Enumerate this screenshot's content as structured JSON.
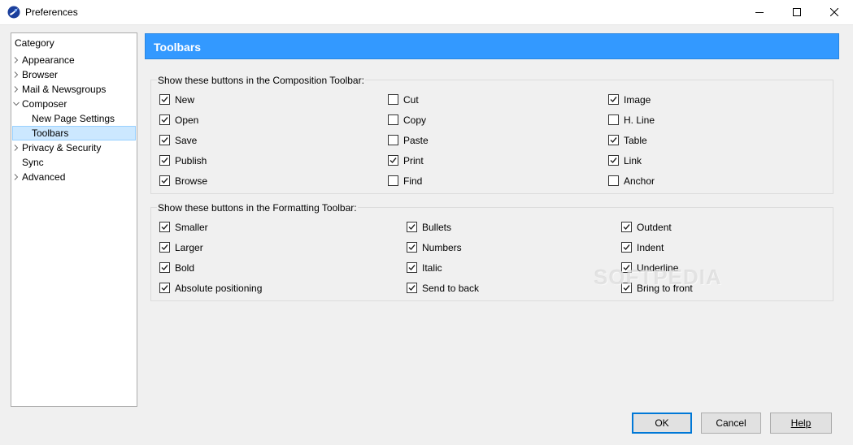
{
  "window": {
    "title": "Preferences"
  },
  "sidebar": {
    "heading": "Category",
    "items": [
      {
        "label": "Appearance",
        "twisty": "collapsed"
      },
      {
        "label": "Browser",
        "twisty": "collapsed"
      },
      {
        "label": "Mail & Newsgroups",
        "twisty": "collapsed"
      },
      {
        "label": "Composer",
        "twisty": "expanded"
      },
      {
        "label": "New Page Settings",
        "twisty": "none"
      },
      {
        "label": "Toolbars",
        "twisty": "none",
        "selected": true
      },
      {
        "label": "Privacy & Security",
        "twisty": "collapsed"
      },
      {
        "label": "Sync",
        "twisty": "none"
      },
      {
        "label": "Advanced",
        "twisty": "collapsed"
      }
    ]
  },
  "panel": {
    "title": "Toolbars",
    "composition": {
      "legend": "Show these buttons in the Composition Toolbar:",
      "items": [
        {
          "label": "New",
          "checked": true
        },
        {
          "label": "Open",
          "checked": true
        },
        {
          "label": "Save",
          "checked": true
        },
        {
          "label": "Publish",
          "checked": true
        },
        {
          "label": "Browse",
          "checked": true
        },
        {
          "label": "Cut",
          "checked": false
        },
        {
          "label": "Copy",
          "checked": false
        },
        {
          "label": "Paste",
          "checked": false
        },
        {
          "label": "Print",
          "checked": true
        },
        {
          "label": "Find",
          "checked": false
        },
        {
          "label": "Image",
          "checked": true
        },
        {
          "label": "H. Line",
          "checked": false
        },
        {
          "label": "Table",
          "checked": true
        },
        {
          "label": "Link",
          "checked": true
        },
        {
          "label": "Anchor",
          "checked": false
        }
      ]
    },
    "formatting": {
      "legend": "Show these buttons in the Formatting Toolbar:",
      "items": [
        {
          "label": "Smaller",
          "checked": true
        },
        {
          "label": "Larger",
          "checked": true
        },
        {
          "label": "Bold",
          "checked": true
        },
        {
          "label": "Absolute positioning",
          "checked": true
        },
        {
          "label": "Bullets",
          "checked": true
        },
        {
          "label": "Numbers",
          "checked": true
        },
        {
          "label": "Italic",
          "checked": true
        },
        {
          "label": "Send to back",
          "checked": true
        },
        {
          "label": "Outdent",
          "checked": true
        },
        {
          "label": "Indent",
          "checked": true
        },
        {
          "label": "Underline",
          "checked": true
        },
        {
          "label": "Bring to front",
          "checked": true
        }
      ]
    }
  },
  "buttons": {
    "ok": "OK",
    "cancel": "Cancel",
    "help": "Help"
  },
  "watermark": "SOFTPEDIA",
  "colors": {
    "accent": "#3399ff",
    "selection": "#cce8ff",
    "default_button_border": "#0078d7"
  }
}
